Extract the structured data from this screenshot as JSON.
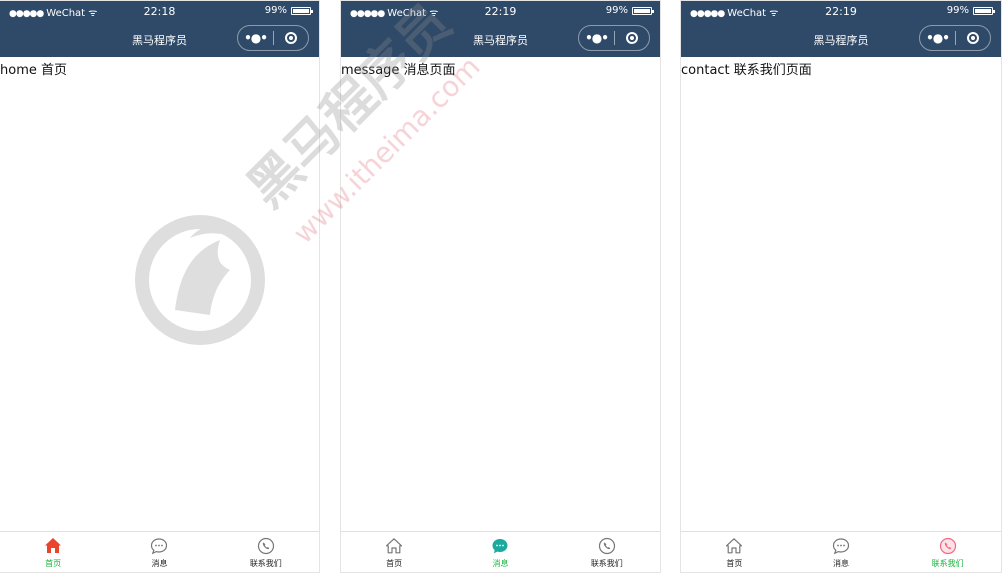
{
  "app_title": "黑马程序员",
  "status": {
    "carrier": "WeChat",
    "battery": "99%"
  },
  "watermark": {
    "brand": "黑马程序员",
    "url": "www.itheima.com"
  },
  "phones": [
    {
      "time": "22:18",
      "page_text": "home 首页",
      "active_tab": 0
    },
    {
      "time": "22:19",
      "page_text": "message 消息页面",
      "active_tab": 1
    },
    {
      "time": "22:19",
      "page_text": "contact 联系我们页面",
      "active_tab": 2
    }
  ],
  "tabs": [
    {
      "label": "首页",
      "icon": "home-icon"
    },
    {
      "label": "消息",
      "icon": "message-icon"
    },
    {
      "label": "联系我们",
      "icon": "phone-icon"
    }
  ],
  "colors": {
    "navbar": "#2f4a68",
    "active_label": "#17b33a",
    "home_active": "#e8452c",
    "message_active": "#1aab9e",
    "contact_active": "#f06a82",
    "icon_inactive": "#777777"
  }
}
